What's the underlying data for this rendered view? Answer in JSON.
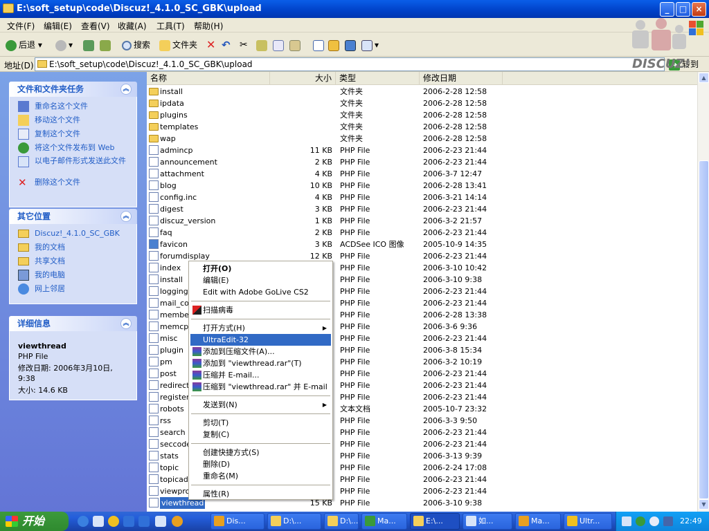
{
  "window": {
    "title": "E:\\soft_setup\\code\\Discuz!_4.1.0_SC_GBK\\upload",
    "minimize": "_",
    "maximize": "□",
    "close": "×"
  },
  "menu": [
    "文件(F)",
    "编辑(E)",
    "查看(V)",
    "收藏(A)",
    "工具(T)",
    "帮助(H)"
  ],
  "toolbar": {
    "back": "后退",
    "search": "搜索",
    "folders": "文件夹"
  },
  "address": {
    "label": "地址(D)",
    "value": "E:\\soft_setup\\code\\Discuz!_4.1.0_SC_GBK\\upload",
    "go": "转到"
  },
  "logo": {
    "text": "DISCUZ!"
  },
  "tasks": {
    "title": "文件和文件夹任务",
    "items": [
      {
        "label": "重命名这个文件",
        "icon": "rename-icon"
      },
      {
        "label": "移动这个文件",
        "icon": "move-icon"
      },
      {
        "label": "复制这个文件",
        "icon": "copy-icon"
      },
      {
        "label": "将这个文件发布到 Web",
        "icon": "web-publish-icon"
      },
      {
        "label": "以电子邮件形式发送此文件",
        "icon": "email-icon"
      },
      {
        "label": "删除这个文件",
        "icon": "delete-icon"
      }
    ]
  },
  "places": {
    "title": "其它位置",
    "items": [
      {
        "label": "Discuz!_4.1.0_SC_GBK",
        "icon": "folder-icon"
      },
      {
        "label": "我的文档",
        "icon": "my-documents-icon"
      },
      {
        "label": "共享文档",
        "icon": "shared-documents-icon"
      },
      {
        "label": "我的电脑",
        "icon": "my-computer-icon"
      },
      {
        "label": "网上邻居",
        "icon": "network-icon"
      }
    ]
  },
  "details": {
    "title": "详细信息",
    "name": "viewthread",
    "type": "PHP File",
    "modified_label": "修改日期: 2006年3月10日,",
    "modified_time": "9:38",
    "size": "大小: 14.6 KB"
  },
  "columns": {
    "name": "名称",
    "size": "大小",
    "type": "类型",
    "date": "修改日期"
  },
  "files": [
    {
      "name": "install",
      "size": "",
      "type": "文件夹",
      "date": "2006-2-28 12:58",
      "kind": "folder"
    },
    {
      "name": "ipdata",
      "size": "",
      "type": "文件夹",
      "date": "2006-2-28 12:58",
      "kind": "folder"
    },
    {
      "name": "plugins",
      "size": "",
      "type": "文件夹",
      "date": "2006-2-28 12:58",
      "kind": "folder"
    },
    {
      "name": "templates",
      "size": "",
      "type": "文件夹",
      "date": "2006-2-28 12:58",
      "kind": "folder"
    },
    {
      "name": "wap",
      "size": "",
      "type": "文件夹",
      "date": "2006-2-28 12:58",
      "kind": "folder"
    },
    {
      "name": "admincp",
      "size": "11 KB",
      "type": "PHP File",
      "date": "2006-2-23 21:44",
      "kind": "php"
    },
    {
      "name": "announcement",
      "size": "2 KB",
      "type": "PHP File",
      "date": "2006-2-23 21:44",
      "kind": "php"
    },
    {
      "name": "attachment",
      "size": "4 KB",
      "type": "PHP File",
      "date": "2006-3-7 12:47",
      "kind": "php"
    },
    {
      "name": "blog",
      "size": "10 KB",
      "type": "PHP File",
      "date": "2006-2-28 13:41",
      "kind": "php"
    },
    {
      "name": "config.inc",
      "size": "4 KB",
      "type": "PHP File",
      "date": "2006-3-21 14:14",
      "kind": "php"
    },
    {
      "name": "digest",
      "size": "3 KB",
      "type": "PHP File",
      "date": "2006-2-23 21:44",
      "kind": "php"
    },
    {
      "name": "discuz_version",
      "size": "1 KB",
      "type": "PHP File",
      "date": "2006-3-2 21:57",
      "kind": "php"
    },
    {
      "name": "faq",
      "size": "2 KB",
      "type": "PHP File",
      "date": "2006-2-23 21:44",
      "kind": "php"
    },
    {
      "name": "favicon",
      "size": "3 KB",
      "type": "ACDSee ICO 图像",
      "date": "2005-10-9 14:35",
      "kind": "ico"
    },
    {
      "name": "forumdisplay",
      "size": "12 KB",
      "type": "PHP File",
      "date": "2006-2-23 21:44",
      "kind": "php"
    },
    {
      "name": "index",
      "size": "",
      "type": "PHP File",
      "date": "2006-3-10 10:42",
      "kind": "php"
    },
    {
      "name": "install",
      "size": "",
      "type": "PHP File",
      "date": "2006-3-10 9:38",
      "kind": "php"
    },
    {
      "name": "logging",
      "size": "",
      "type": "PHP File",
      "date": "2006-2-23 21:44",
      "kind": "php"
    },
    {
      "name": "mail_con",
      "size": "",
      "type": "PHP File",
      "date": "2006-2-23 21:44",
      "kind": "php"
    },
    {
      "name": "member",
      "size": "",
      "type": "PHP File",
      "date": "2006-2-28 13:38",
      "kind": "php"
    },
    {
      "name": "memcp",
      "size": "",
      "type": "PHP File",
      "date": "2006-3-6 9:36",
      "kind": "php"
    },
    {
      "name": "misc",
      "size": "",
      "type": "PHP File",
      "date": "2006-2-23 21:44",
      "kind": "php"
    },
    {
      "name": "plugin",
      "size": "",
      "type": "PHP File",
      "date": "2006-3-8 15:34",
      "kind": "php"
    },
    {
      "name": "pm",
      "size": "",
      "type": "PHP File",
      "date": "2006-3-2 10:19",
      "kind": "php"
    },
    {
      "name": "post",
      "size": "",
      "type": "PHP File",
      "date": "2006-2-23 21:44",
      "kind": "php"
    },
    {
      "name": "redirect",
      "size": "",
      "type": "PHP File",
      "date": "2006-2-23 21:44",
      "kind": "php"
    },
    {
      "name": "register",
      "size": "",
      "type": "PHP File",
      "date": "2006-2-23 21:44",
      "kind": "php"
    },
    {
      "name": "robots",
      "size": "",
      "type": "文本文档",
      "date": "2005-10-7 23:32",
      "kind": "txt"
    },
    {
      "name": "rss",
      "size": "",
      "type": "PHP File",
      "date": "2006-3-3 9:50",
      "kind": "php"
    },
    {
      "name": "search",
      "size": "",
      "type": "PHP File",
      "date": "2006-2-23 21:44",
      "kind": "php"
    },
    {
      "name": "seccode",
      "size": "",
      "type": "PHP File",
      "date": "2006-2-23 21:44",
      "kind": "php"
    },
    {
      "name": "stats",
      "size": "",
      "type": "PHP File",
      "date": "2006-3-13 9:39",
      "kind": "php"
    },
    {
      "name": "topic",
      "size": "",
      "type": "PHP File",
      "date": "2006-2-24 17:08",
      "kind": "php"
    },
    {
      "name": "topicadm",
      "size": "",
      "type": "PHP File",
      "date": "2006-2-23 21:44",
      "kind": "php"
    },
    {
      "name": "viewpro",
      "size": "",
      "type": "PHP File",
      "date": "2006-2-23 21:44",
      "kind": "php"
    },
    {
      "name": "viewthread",
      "size": "15 KB",
      "type": "PHP File",
      "date": "2006-3-10 9:38",
      "kind": "php",
      "selected": true
    }
  ],
  "context_menu": [
    {
      "label": "打开(O)",
      "bold": true
    },
    {
      "label": "编辑(E)"
    },
    {
      "label": "Edit with Adobe GoLive CS2"
    },
    {
      "sep": true
    },
    {
      "label": "扫描病毒",
      "icon": "kaspersky-icon"
    },
    {
      "sep": true
    },
    {
      "label": "打开方式(H)",
      "submenu": true
    },
    {
      "label": "UltraEdit-32",
      "highlight": true
    },
    {
      "label": "添加到压缩文件(A)...",
      "icon": "winrar-icon"
    },
    {
      "label": "添加到 \"viewthread.rar\"(T)",
      "icon": "winrar-icon"
    },
    {
      "label": "压缩并 E-mail...",
      "icon": "winrar-icon"
    },
    {
      "label": "压缩到 \"viewthread.rar\" 并 E-mail",
      "icon": "winrar-icon"
    },
    {
      "sep": true
    },
    {
      "label": "发送到(N)",
      "submenu": true
    },
    {
      "sep": true
    },
    {
      "label": "剪切(T)"
    },
    {
      "label": "复制(C)"
    },
    {
      "sep": true
    },
    {
      "label": "创建快捷方式(S)"
    },
    {
      "label": "删除(D)"
    },
    {
      "label": "重命名(M)"
    },
    {
      "sep": true
    },
    {
      "label": "属性(R)"
    }
  ],
  "taskbar": {
    "start": "开始",
    "buttons": [
      {
        "label": "Dis...",
        "color": "#e8a020"
      },
      {
        "label": "D:\\...",
        "color": "#f4cf5a"
      },
      {
        "label": "D:\\...",
        "color": "#f4cf5a"
      },
      {
        "label": "Ma...",
        "color": "#3a9a3a"
      },
      {
        "label": "E:\\...",
        "color": "#f4cf5a",
        "active": true
      },
      {
        "label": "如...",
        "color": "#d8e4f8"
      },
      {
        "label": "Ma...",
        "color": "#e8a020"
      },
      {
        "label": "Ultr...",
        "color": "#f0c020"
      }
    ],
    "clock": "22:49"
  }
}
